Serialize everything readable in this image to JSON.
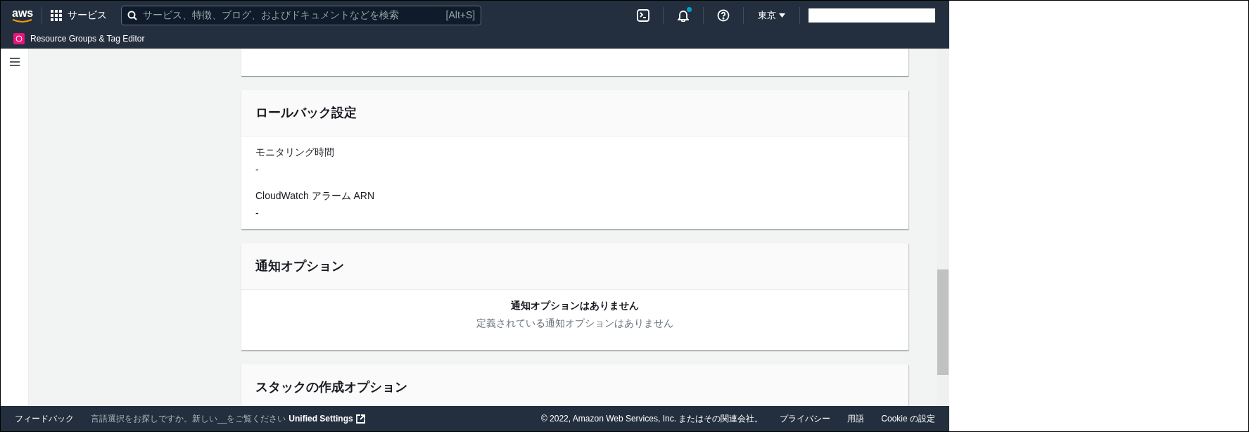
{
  "header": {
    "logo_text": "aws",
    "services_label": "サービス",
    "search": {
      "placeholder": "サービス、特徴、ブログ、およびドキュメントなどを検索",
      "shortcut": "[Alt+S]"
    },
    "notification_dot": true,
    "region": "東京",
    "app_name": "Resource Groups & Tag Editor"
  },
  "sections": [
    {
      "kind": "fields",
      "title": "ロールバック設定",
      "fields": [
        {
          "label": "モニタリング時間",
          "value": "-"
        },
        {
          "label": "CloudWatch アラーム ARN",
          "value": "-"
        }
      ]
    },
    {
      "kind": "empty",
      "title": "通知オプション",
      "empty_title": "通知オプションはありません",
      "empty_text": "定義されている通知オプションはありません"
    },
    {
      "kind": "header_only",
      "title": "スタックの作成オプション"
    }
  ],
  "footer": {
    "feedback": "フィードバック",
    "language_note": "言語選択をお探しですか。新しい__をご覧ください",
    "unified_settings": "Unified Settings",
    "copyright": "© 2022, Amazon Web Services, Inc. またはその関連会社。",
    "links": [
      "プライバシー",
      "用語",
      "Cookie の設定"
    ]
  }
}
